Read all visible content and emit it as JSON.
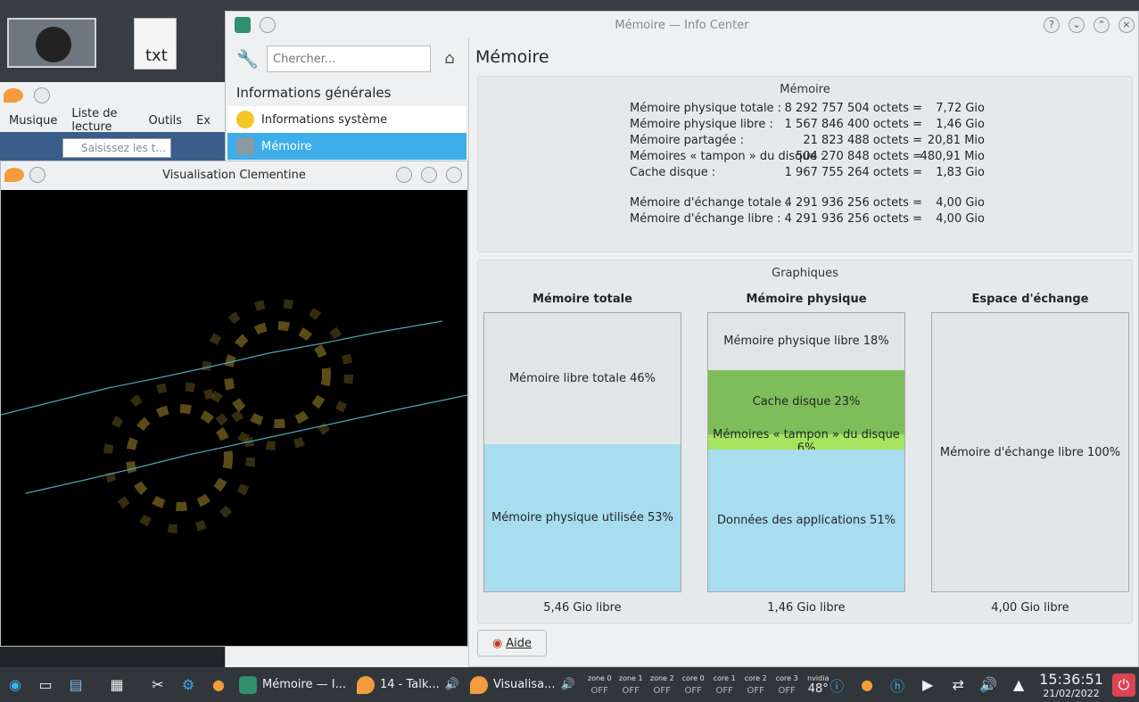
{
  "desktop": {
    "file_label": "txt"
  },
  "clementine_main": {
    "menus": [
      "Musique",
      "Liste de lecture",
      "Outils",
      "Ex"
    ],
    "search_placeholder": "Saisissez les t..."
  },
  "info_center": {
    "window_title": "Mémoire — Info Center",
    "search_placeholder": "Chercher...",
    "group_heading": "Informations générales",
    "nav_items": [
      "Informations système",
      "Mémoire"
    ],
    "page_title": "Mémoire",
    "memory_panel": {
      "title": "Mémoire",
      "rows": [
        {
          "label": "Mémoire physique totale :",
          "bytes": "8 292 757 504 octets =",
          "human": "7,72 Gio"
        },
        {
          "label": "Mémoire physique libre :",
          "bytes": "1 567 846 400 octets =",
          "human": "1,46 Gio"
        },
        {
          "label": "Mémoire partagée :",
          "bytes": "21 823 488 octets =",
          "human": "20,81 Mio"
        },
        {
          "label": "Mémoires « tampon » du disque :",
          "bytes": "504 270 848 octets =",
          "human": "480,91 Mio"
        },
        {
          "label": "Cache disque :",
          "bytes": "1 967 755 264 octets =",
          "human": "1,83 Gio"
        },
        {
          "label": "Mémoire d'échange totale :",
          "bytes": "4 291 936 256 octets =",
          "human": "4,00 Gio"
        },
        {
          "label": "Mémoire d'échange libre :",
          "bytes": "4 291 936 256 octets =",
          "human": "4,00 Gio"
        }
      ]
    },
    "graphs": {
      "title": "Graphiques",
      "columns": [
        {
          "title": "Mémoire totale",
          "segments": [
            {
              "label": "Mémoire libre totale 46%",
              "percent": 47,
              "color": "#e2e5e6"
            },
            {
              "label": "Mémoire physique utilisée 53%",
              "percent": 53,
              "color": "#a8dcef"
            }
          ],
          "free": "5,46 Gio libre"
        },
        {
          "title": "Mémoire physique",
          "segments": [
            {
              "label": "Mémoire physique libre 18%",
              "percent": 20.5,
              "color": "#e2e5e6"
            },
            {
              "label": "Cache disque 23%",
              "percent": 23,
              "color": "#7fbd5a"
            },
            {
              "label": "Mémoires « tampon » du disque 6%",
              "percent": 5.5,
              "color": "#a6e35e"
            },
            {
              "label": "Données des applications 51%",
              "percent": 51,
              "color": "#a8dcef"
            }
          ],
          "free": "1,46 Gio libre"
        },
        {
          "title": "Espace d'échange",
          "segments": [
            {
              "label": "Mémoire d'échange libre 100%",
              "percent": 100,
              "color": "#e2e5e6"
            }
          ],
          "free": "4,00 Gio libre"
        }
      ]
    },
    "help_button": "Aide"
  },
  "visualisation": {
    "title": "Visualisation Clementine"
  },
  "taskbar": {
    "tasks": [
      "Mémoire — I...",
      "14 - Talk...",
      "Visualisa..."
    ],
    "sensors": [
      {
        "name": "zone 0",
        "value": "OFF"
      },
      {
        "name": "zone 1",
        "value": "OFF"
      },
      {
        "name": "zone 2",
        "value": "OFF"
      },
      {
        "name": "core 0",
        "value": "OFF"
      },
      {
        "name": "core 1",
        "value": "OFF"
      },
      {
        "name": "core 2",
        "value": "OFF"
      },
      {
        "name": "core 3",
        "value": "OFF"
      },
      {
        "name": "nvidia",
        "value": "48°"
      }
    ],
    "time": "15:36:51",
    "date": "21/02/2022"
  }
}
